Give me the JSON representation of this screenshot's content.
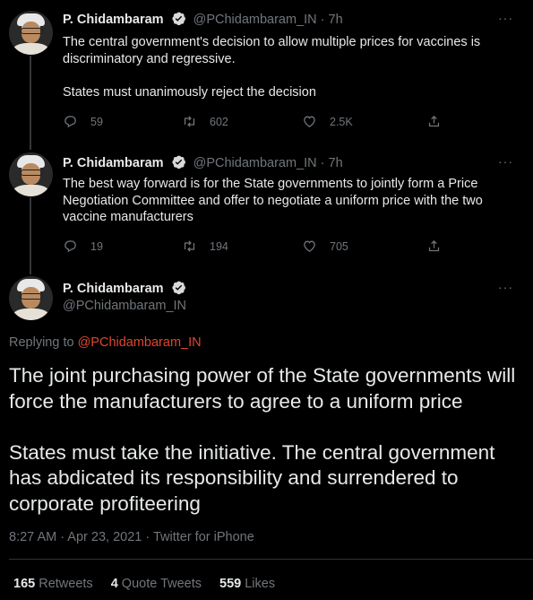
{
  "tweets": [
    {
      "name": "P. Chidambaram",
      "handle": "@PChidambaram_IN · 7h",
      "text": "The central government's decision to allow multiple prices for  vaccines is discriminatory and   regressive.\n\nStates must unanimously reject the decision",
      "replies": "59",
      "retweets": "602",
      "likes": "2.5K"
    },
    {
      "name": "P. Chidambaram",
      "handle": "@PChidambaram_IN · 7h",
      "text": "The best way forward is for the State governments to jointly form a Price Negotiation Committee and offer to negotiate a uniform price with the two vaccine manufacturers",
      "replies": "19",
      "retweets": "194",
      "likes": "705"
    }
  ],
  "main": {
    "name": "P. Chidambaram",
    "handle": "@PChidambaram_IN",
    "replying_prefix": "Replying to ",
    "replying_to": "@PChidambaram_IN",
    "text": "The joint purchasing power of the State governments will force the manufacturers to agree to a uniform price\n\nStates must take the initiative. The central government has abdicated its responsibility and surrendered to corporate profiteering",
    "meta": "8:27 AM · Apr 23, 2021 · Twitter for iPhone",
    "retweets_count": "165",
    "retweets_label": "Retweets",
    "quotes_count": "4",
    "quotes_label": "Quote Tweets",
    "likes_count": "559",
    "likes_label": "Likes"
  },
  "more_label": "···",
  "colors": {
    "background": "#000000",
    "text": "#e7e9ea",
    "muted": "#71767b",
    "link": "#e0452f",
    "verified": "#d9d9d9"
  },
  "icons": [
    "reply-icon",
    "retweet-icon",
    "like-icon",
    "share-icon",
    "verified-badge-icon",
    "more-icon"
  ]
}
